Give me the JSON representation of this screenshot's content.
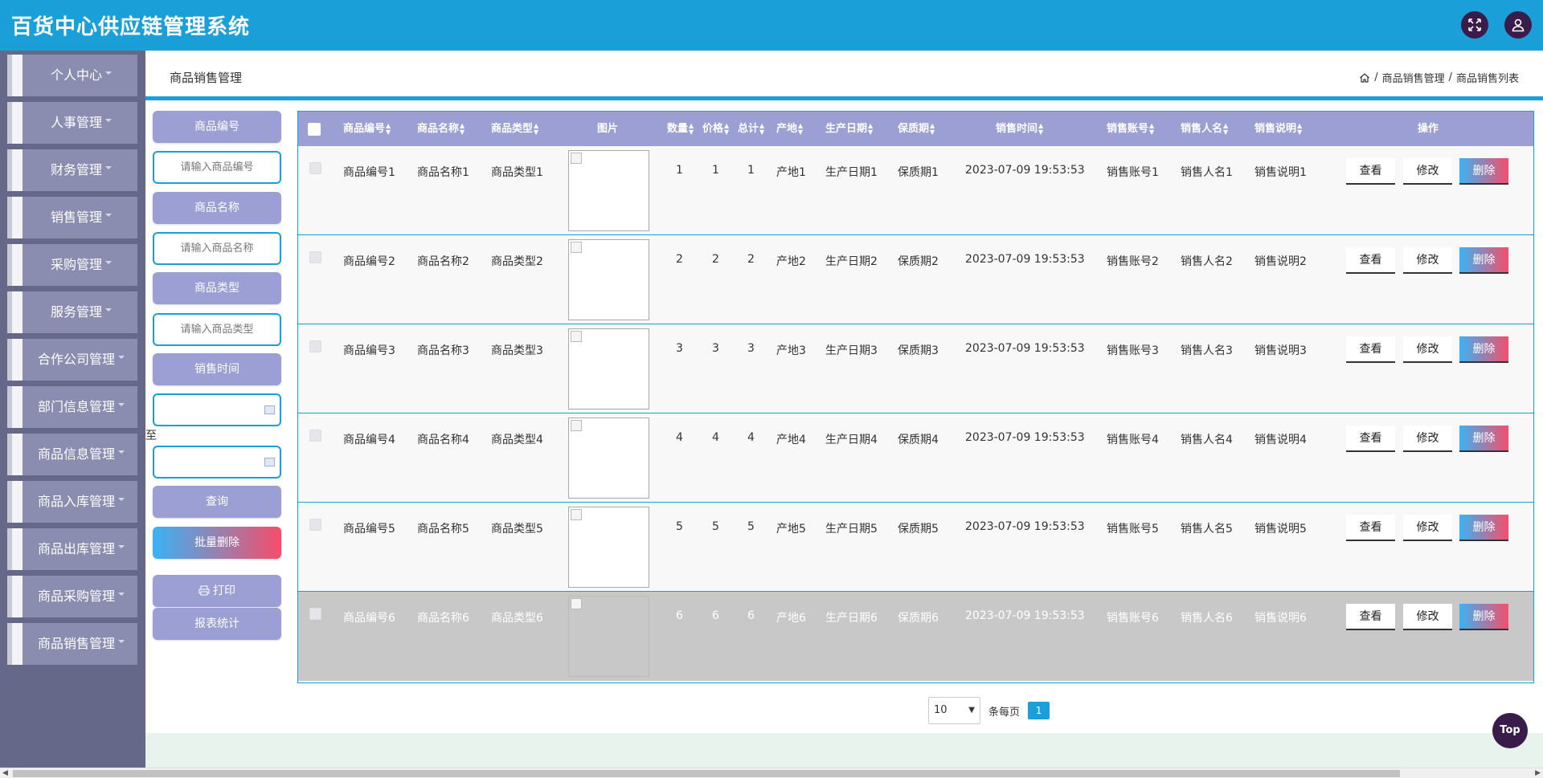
{
  "app": {
    "title": "百货中心供应链管理系统"
  },
  "sidebar": {
    "items": [
      {
        "label": "个人中心"
      },
      {
        "label": "人事管理"
      },
      {
        "label": "财务管理"
      },
      {
        "label": "销售管理"
      },
      {
        "label": "采购管理"
      },
      {
        "label": "服务管理"
      },
      {
        "label": "合作公司管理"
      },
      {
        "label": "部门信息管理"
      },
      {
        "label": "商品信息管理"
      },
      {
        "label": "商品入库管理"
      },
      {
        "label": "商品出库管理"
      },
      {
        "label": "商品采购管理"
      },
      {
        "label": "商品销售管理"
      }
    ]
  },
  "page": {
    "title": "商品销售管理",
    "breadcrumb": [
      "商品销售管理",
      "商品销售列表"
    ],
    "separator": "/"
  },
  "search": {
    "code_label": "商品编号",
    "code_placeholder": "请输入商品编号",
    "name_label": "商品名称",
    "name_placeholder": "请输入商品名称",
    "type_label": "商品类型",
    "type_placeholder": "请输入商品类型",
    "time_label": "销售时间",
    "to_label": "至",
    "query_label": "查询",
    "batch_delete_label": "批量删除",
    "print_label": "打印",
    "report_label": "报表统计"
  },
  "table": {
    "headers": {
      "code": "商品编号",
      "name": "商品名称",
      "type": "商品类型",
      "image": "图片",
      "qty": "数量",
      "price": "价格",
      "total": "总计",
      "origin": "产地",
      "mfg": "生产日期",
      "shelf": "保质期",
      "time": "销售时间",
      "account": "销售账号",
      "seller": "销售人名",
      "note": "销售说明",
      "ops": "操作"
    },
    "actions": {
      "view": "查看",
      "edit": "修改",
      "delete": "删除"
    },
    "rows": [
      {
        "code": "商品编号1",
        "name": "商品名称1",
        "type": "商品类型1",
        "qty": "1",
        "price": "1",
        "total": "1",
        "origin": "产地1",
        "mfg": "生产日期1",
        "shelf": "保质期1",
        "time": "2023-07-09 19:53:53",
        "account": "销售账号1",
        "seller": "销售人名1",
        "note": "销售说明1"
      },
      {
        "code": "商品编号2",
        "name": "商品名称2",
        "type": "商品类型2",
        "qty": "2",
        "price": "2",
        "total": "2",
        "origin": "产地2",
        "mfg": "生产日期2",
        "shelf": "保质期2",
        "time": "2023-07-09 19:53:53",
        "account": "销售账号2",
        "seller": "销售人名2",
        "note": "销售说明2"
      },
      {
        "code": "商品编号3",
        "name": "商品名称3",
        "type": "商品类型3",
        "qty": "3",
        "price": "3",
        "total": "3",
        "origin": "产地3",
        "mfg": "生产日期3",
        "shelf": "保质期3",
        "time": "2023-07-09 19:53:53",
        "account": "销售账号3",
        "seller": "销售人名3",
        "note": "销售说明3"
      },
      {
        "code": "商品编号4",
        "name": "商品名称4",
        "type": "商品类型4",
        "qty": "4",
        "price": "4",
        "total": "4",
        "origin": "产地4",
        "mfg": "生产日期4",
        "shelf": "保质期4",
        "time": "2023-07-09 19:53:53",
        "account": "销售账号4",
        "seller": "销售人名4",
        "note": "销售说明4"
      },
      {
        "code": "商品编号5",
        "name": "商品名称5",
        "type": "商品类型5",
        "qty": "5",
        "price": "5",
        "total": "5",
        "origin": "产地5",
        "mfg": "生产日期5",
        "shelf": "保质期5",
        "time": "2023-07-09 19:53:53",
        "account": "销售账号5",
        "seller": "销售人名5",
        "note": "销售说明5"
      },
      {
        "code": "商品编号6",
        "name": "商品名称6",
        "type": "商品类型6",
        "qty": "6",
        "price": "6",
        "total": "6",
        "origin": "产地6",
        "mfg": "生产日期6",
        "shelf": "保质期6",
        "time": "2023-07-09 19:53:53",
        "account": "销售账号6",
        "seller": "销售人名6",
        "note": "销售说明6"
      }
    ]
  },
  "pagination": {
    "page_size": "10",
    "per_page_label": "条每页",
    "current_page": "1"
  },
  "back_to_top": "Top",
  "colors": {
    "primary": "#1a9fd9",
    "sidebar": "#666889",
    "sidebar_item": "#8a8cb0",
    "button": "#9b9fd4",
    "accent_dark": "#3a1c4a"
  }
}
